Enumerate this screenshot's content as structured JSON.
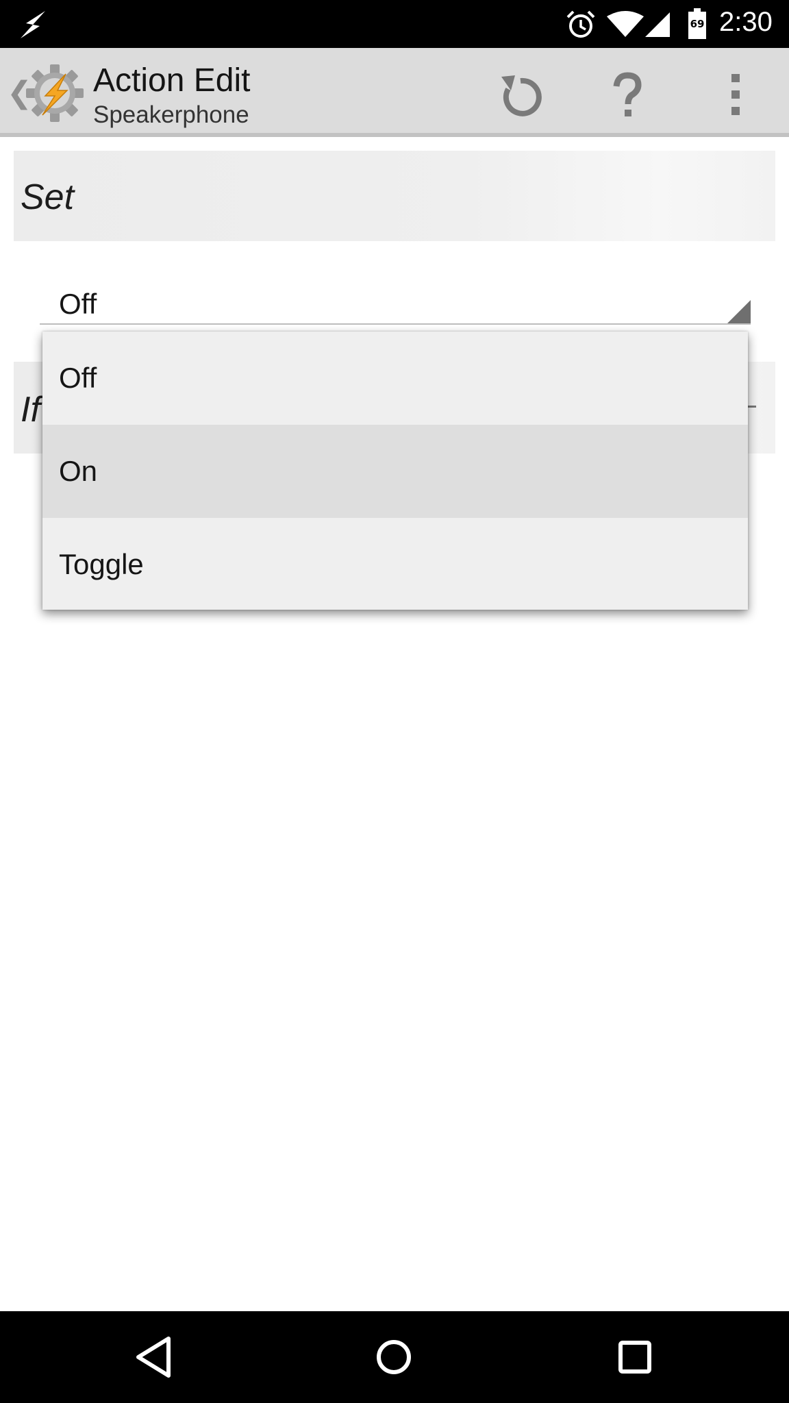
{
  "status_bar": {
    "time": "2:30",
    "battery_level": "69",
    "icons": [
      "lightning-bolt-icon",
      "alarm-clock-icon",
      "wifi-icon",
      "cell-signal-icon",
      "battery-icon"
    ]
  },
  "action_bar": {
    "title": "Action Edit",
    "subtitle": "Speakerphone",
    "icons": {
      "up": "chevron-left-icon",
      "app": "tasker-gear-bolt-icon",
      "revert": "revert-icon",
      "help": "help-question-icon",
      "more": "overflow-menu-icon"
    }
  },
  "form": {
    "set_label": "Set",
    "set_value": "Off",
    "if_label": "If"
  },
  "dropdown": {
    "options": [
      "Off",
      "On",
      "Toggle"
    ],
    "highlighted_index": 1
  },
  "nav_bar": {
    "icons": [
      "back-icon",
      "home-icon",
      "recents-icon"
    ]
  },
  "colors": {
    "action_bar_bg": "#dcdcdc",
    "section_bg": "#ececec",
    "dropdown_bg": "#efefef",
    "dropdown_highlight": "#dedede",
    "bolt_orange": "#f5a623"
  }
}
